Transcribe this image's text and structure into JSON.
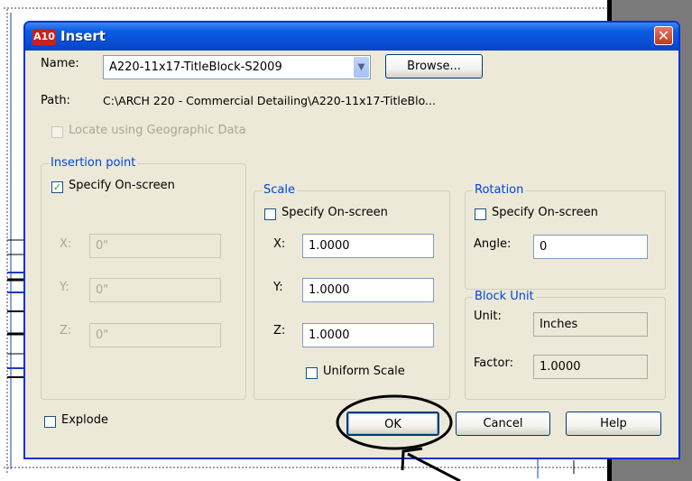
{
  "dialog": {
    "title": "Insert",
    "app_icon_text": "A10",
    "close_symbol": "✕"
  },
  "name": {
    "label": "Name:",
    "value": "A220-11x17-TitleBlock-S2009",
    "browse_label": "Browse..."
  },
  "path": {
    "label": "Path:",
    "value": "C:\\ARCH 220 - Commercial Detailing\\A220-11x17-TitleBlo..."
  },
  "geo": {
    "label": "Locate using Geographic Data",
    "checked": false,
    "enabled": false
  },
  "insertion_point": {
    "title": "Insertion point",
    "specify_label": "Specify On-screen",
    "specify_checked": true,
    "x_label": "X:",
    "x_value": "0\"",
    "y_label": "Y:",
    "y_value": "0\"",
    "z_label": "Z:",
    "z_value": "0\""
  },
  "scale": {
    "title": "Scale",
    "specify_label": "Specify On-screen",
    "specify_checked": false,
    "x_label": "X:",
    "x_value": "1.0000",
    "y_label": "Y:",
    "y_value": "1.0000",
    "z_label": "Z:",
    "z_value": "1.0000",
    "uniform_label": "Uniform Scale",
    "uniform_checked": false
  },
  "rotation": {
    "title": "Rotation",
    "specify_label": "Specify On-screen",
    "specify_checked": false,
    "angle_label": "Angle:",
    "angle_value": "0"
  },
  "block_unit": {
    "title": "Block Unit",
    "unit_label": "Unit:",
    "unit_value": "Inches",
    "factor_label": "Factor:",
    "factor_value": "1.0000"
  },
  "explode": {
    "label": "Explode",
    "checked": false
  },
  "buttons": {
    "ok": "OK",
    "cancel": "Cancel",
    "help": "Help"
  },
  "colors": {
    "title_bar": "#0a5ee2",
    "dialog_bg": "#ece9d8",
    "group_title": "#0046d5",
    "check_mark": "#21a121"
  },
  "icons": {
    "combo": "chevron-down-icon",
    "close": "close-icon",
    "check": "checkmark-icon"
  }
}
